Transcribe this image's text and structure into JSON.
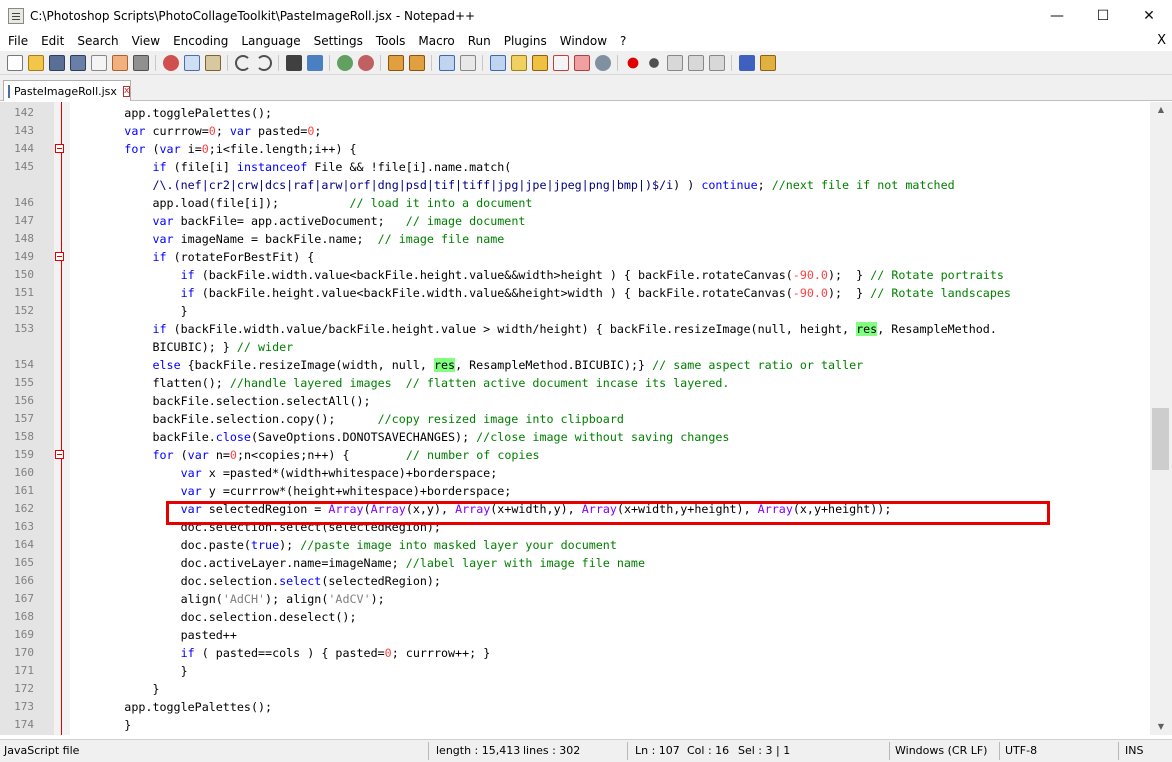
{
  "window": {
    "title": "C:\\Photoshop Scripts\\PhotoCollageToolkit\\PasteImageRoll.jsx - Notepad++",
    "min": "—",
    "max": "☐",
    "close": "✕"
  },
  "menu": {
    "items": [
      "File",
      "Edit",
      "Search",
      "View",
      "Encoding",
      "Language",
      "Settings",
      "Tools",
      "Macro",
      "Run",
      "Plugins",
      "Window",
      "?"
    ],
    "close": "X"
  },
  "toolbar": {
    "icons": [
      "new-file",
      "open-file",
      "save",
      "save-all",
      "close",
      "close-all",
      "print",
      "sep",
      "cut",
      "copy",
      "paste",
      "sep",
      "undo",
      "redo",
      "sep",
      "find",
      "replace",
      "sep",
      "zoom-in",
      "zoom-out",
      "sep",
      "sync-v",
      "sync-h",
      "sep",
      "word-wrap",
      "show-all-chars",
      "sep",
      "indent-guide",
      "user-lang",
      "doc-map",
      "function-list",
      "folder-workspace",
      "monitor",
      "sep",
      "record-macro",
      "stop-record",
      "play-macro",
      "play-multiple",
      "save-macro",
      "sep",
      "spellcheck",
      "plugin"
    ]
  },
  "tab": {
    "label": "PasteImageRoll.jsx",
    "close": "x"
  },
  "editor": {
    "lines": [
      {
        "n": "142",
        "fold": false
      },
      {
        "n": "143",
        "fold": false
      },
      {
        "n": "144",
        "fold": true
      },
      {
        "n": "145",
        "fold": false
      },
      {
        "n": "",
        "fold": false
      },
      {
        "n": "146",
        "fold": false
      },
      {
        "n": "147",
        "fold": false
      },
      {
        "n": "148",
        "fold": false
      },
      {
        "n": "149",
        "fold": true
      },
      {
        "n": "150",
        "fold": false
      },
      {
        "n": "151",
        "fold": false
      },
      {
        "n": "152",
        "fold": false
      },
      {
        "n": "153",
        "fold": false
      },
      {
        "n": "",
        "fold": false
      },
      {
        "n": "154",
        "fold": false
      },
      {
        "n": "155",
        "fold": false
      },
      {
        "n": "156",
        "fold": false
      },
      {
        "n": "157",
        "fold": false
      },
      {
        "n": "158",
        "fold": false
      },
      {
        "n": "159",
        "fold": true
      },
      {
        "n": "160",
        "fold": false
      },
      {
        "n": "161",
        "fold": false
      },
      {
        "n": "162",
        "fold": false
      },
      {
        "n": "163",
        "fold": false
      },
      {
        "n": "164",
        "fold": false
      },
      {
        "n": "165",
        "fold": false
      },
      {
        "n": "166",
        "fold": false
      },
      {
        "n": "167",
        "fold": false
      },
      {
        "n": "168",
        "fold": false
      },
      {
        "n": "169",
        "fold": false
      },
      {
        "n": "170",
        "fold": false
      },
      {
        "n": "171",
        "fold": false
      },
      {
        "n": "172",
        "fold": false
      },
      {
        "n": "173",
        "fold": false
      },
      {
        "n": "174",
        "fold": false
      }
    ],
    "highlighted_line": "162"
  },
  "status": {
    "file_type": "JavaScript file",
    "length": "length : 15,413",
    "lines": "lines : 302",
    "ln": "Ln : 107",
    "col": "Col : 16",
    "sel": "Sel : 3 | 1",
    "eol": "Windows (CR LF)",
    "encoding": "UTF-8",
    "mode": "INS"
  }
}
